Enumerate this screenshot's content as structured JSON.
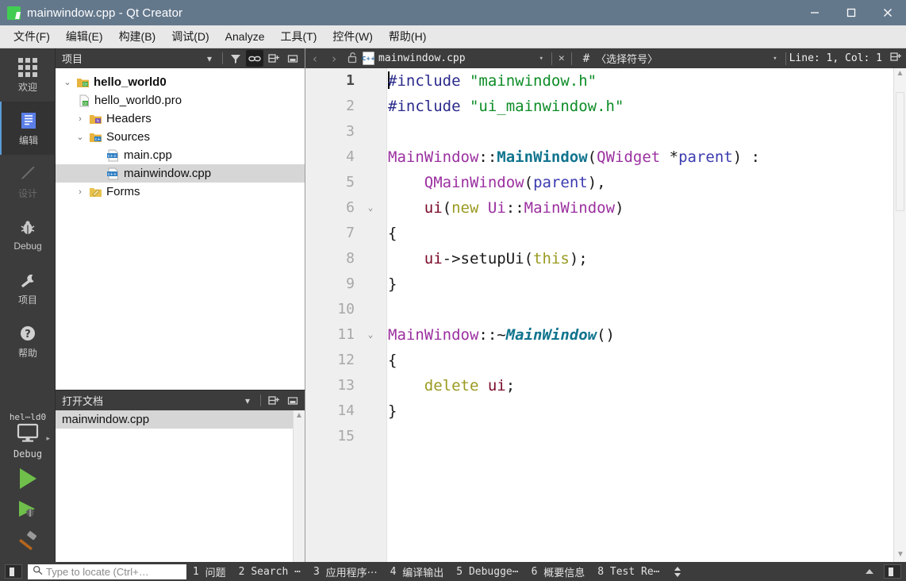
{
  "window": {
    "title": "mainwindow.cpp - Qt Creator",
    "app_icon": "qt-logo-icon",
    "minimize": "—",
    "maximize": "☐",
    "close": "✕",
    "titlebar_color": "#64788c"
  },
  "menubar": {
    "items": [
      {
        "label": "文件(F)",
        "mnemonic": "F"
      },
      {
        "label": "编辑(E)",
        "mnemonic": "E"
      },
      {
        "label": "构建(B)",
        "mnemonic": "B"
      },
      {
        "label": "调试(D)",
        "mnemonic": "D"
      },
      {
        "label": "Analyze",
        "mnemonic": "A"
      },
      {
        "label": "工具(T)",
        "mnemonic": "T"
      },
      {
        "label": "控件(W)",
        "mnemonic": "W"
      },
      {
        "label": "帮助(H)",
        "mnemonic": "H"
      }
    ]
  },
  "modebar": {
    "items": [
      {
        "label": "欢迎",
        "icon": "grid-icon",
        "state": "normal"
      },
      {
        "label": "编辑",
        "icon": "document-icon",
        "state": "selected"
      },
      {
        "label": "设计",
        "icon": "pencil-icon",
        "state": "disabled"
      },
      {
        "label": "Debug",
        "icon": "bug-icon",
        "state": "normal"
      },
      {
        "label": "项目",
        "icon": "wrench-icon",
        "state": "normal"
      },
      {
        "label": "帮助",
        "icon": "question-mark-icon",
        "state": "normal"
      }
    ],
    "kit": {
      "project": "hel⋯ld0",
      "config": "Debug",
      "icon": "monitor-icon"
    },
    "actions": [
      {
        "name": "run",
        "icon": "play-triangle-icon"
      },
      {
        "name": "debug",
        "icon": "play-bug-icon"
      },
      {
        "name": "build",
        "icon": "hammer-icon"
      }
    ]
  },
  "project_panel": {
    "title": "项目",
    "tools": [
      {
        "name": "filter-chevron",
        "glyph": "▾",
        "active": false
      },
      {
        "name": "filter-icon",
        "glyph": "▼",
        "active": false
      },
      {
        "name": "sync-link-icon",
        "glyph": "⚭",
        "active": true
      },
      {
        "name": "split-icon",
        "glyph": "⊞",
        "active": false
      },
      {
        "name": "close-panel-icon",
        "glyph": "▣",
        "active": false
      }
    ],
    "tree": [
      {
        "label": "hello_world0",
        "indent": 0,
        "arrow": "⌄",
        "icon": "qt-project-icon",
        "bold": true,
        "selected": false
      },
      {
        "label": "hello_world0.pro",
        "indent": 1,
        "arrow": "",
        "icon": "pro-file-icon",
        "bold": false,
        "selected": false
      },
      {
        "label": "Headers",
        "indent": 1,
        "arrow": "›",
        "icon": "headers-folder-icon",
        "bold": false,
        "selected": false
      },
      {
        "label": "Sources",
        "indent": 1,
        "arrow": "⌄",
        "icon": "sources-folder-icon",
        "bold": false,
        "selected": false
      },
      {
        "label": "main.cpp",
        "indent": 2,
        "arrow": "",
        "icon": "cpp-file-icon",
        "bold": false,
        "selected": false
      },
      {
        "label": "mainwindow.cpp",
        "indent": 2,
        "arrow": "",
        "icon": "cpp-file-icon",
        "bold": false,
        "selected": true
      },
      {
        "label": "Forms",
        "indent": 1,
        "arrow": "›",
        "icon": "forms-folder-icon",
        "bold": false,
        "selected": false
      }
    ]
  },
  "open_documents": {
    "title": "打开文档",
    "tools": [
      {
        "name": "chevron-down-icon",
        "glyph": "▾"
      },
      {
        "name": "split-icon",
        "glyph": "⊞"
      },
      {
        "name": "close-panel-icon",
        "glyph": "▣"
      }
    ],
    "items": [
      {
        "label": "mainwindow.cpp",
        "selected": true
      }
    ]
  },
  "editor_toolbar": {
    "back": "‹",
    "forward": "›",
    "lock_icon": "unlocked-padlock-icon",
    "file_icon": "cpp-file-icon",
    "file_icon_text": "C++",
    "filename": "mainwindow.cpp",
    "file_chevron": "▾",
    "close": "✕",
    "hash": "#",
    "symbol_selector": "〈选择符号〉",
    "symbol_chevron": "▾",
    "cursor_position": "Line: 1, Col: 1",
    "split_icon": "⊞"
  },
  "editor": {
    "lines": [
      {
        "num": "1",
        "fold": "",
        "current": true,
        "tokens": [
          {
            "t": "#include ",
            "c": "s-pre"
          },
          {
            "t": "\"mainwindow.h\"",
            "c": "s-str"
          }
        ]
      },
      {
        "num": "2",
        "fold": "",
        "current": false,
        "tokens": [
          {
            "t": "#include ",
            "c": "s-pre"
          },
          {
            "t": "\"ui_mainwindow.h\"",
            "c": "s-str"
          }
        ]
      },
      {
        "num": "3",
        "fold": "",
        "current": false,
        "tokens": []
      },
      {
        "num": "4",
        "fold": "",
        "current": false,
        "tokens": [
          {
            "t": "MainWindow",
            "c": "s-type"
          },
          {
            "t": "::",
            "c": "s-plain"
          },
          {
            "t": "MainWindow",
            "c": "s-fn"
          },
          {
            "t": "(",
            "c": "s-plain"
          },
          {
            "t": "QWidget",
            "c": "s-type"
          },
          {
            "t": " *",
            "c": "s-plain"
          },
          {
            "t": "parent",
            "c": "s-param"
          },
          {
            "t": ") :",
            "c": "s-plain"
          }
        ]
      },
      {
        "num": "5",
        "fold": "",
        "current": false,
        "tokens": [
          {
            "t": "    ",
            "c": "s-plain"
          },
          {
            "t": "QMainWindow",
            "c": "s-type"
          },
          {
            "t": "(",
            "c": "s-plain"
          },
          {
            "t": "parent",
            "c": "s-param"
          },
          {
            "t": "),",
            "c": "s-plain"
          }
        ]
      },
      {
        "num": "6",
        "fold": "⌄",
        "current": false,
        "tokens": [
          {
            "t": "    ",
            "c": "s-plain"
          },
          {
            "t": "ui",
            "c": "s-var"
          },
          {
            "t": "(",
            "c": "s-plain"
          },
          {
            "t": "new",
            "c": "s-kw"
          },
          {
            "t": " ",
            "c": "s-plain"
          },
          {
            "t": "Ui",
            "c": "s-type"
          },
          {
            "t": "::",
            "c": "s-plain"
          },
          {
            "t": "MainWindow",
            "c": "s-type"
          },
          {
            "t": ")",
            "c": "s-plain"
          }
        ]
      },
      {
        "num": "7",
        "fold": "",
        "current": false,
        "tokens": [
          {
            "t": "{",
            "c": "s-plain"
          }
        ]
      },
      {
        "num": "8",
        "fold": "",
        "current": false,
        "tokens": [
          {
            "t": "    ",
            "c": "s-plain"
          },
          {
            "t": "ui",
            "c": "s-var"
          },
          {
            "t": "->setupUi(",
            "c": "s-plain"
          },
          {
            "t": "this",
            "c": "s-kw"
          },
          {
            "t": ");",
            "c": "s-plain"
          }
        ]
      },
      {
        "num": "9",
        "fold": "",
        "current": false,
        "tokens": [
          {
            "t": "}",
            "c": "s-plain"
          }
        ]
      },
      {
        "num": "10",
        "fold": "",
        "current": false,
        "tokens": []
      },
      {
        "num": "11",
        "fold": "⌄",
        "current": false,
        "tokens": [
          {
            "t": "MainWindow",
            "c": "s-type"
          },
          {
            "t": "::~",
            "c": "s-plain"
          },
          {
            "t": "MainWindow",
            "c": "s-fni"
          },
          {
            "t": "()",
            "c": "s-plain"
          }
        ]
      },
      {
        "num": "12",
        "fold": "",
        "current": false,
        "tokens": [
          {
            "t": "{",
            "c": "s-plain"
          }
        ]
      },
      {
        "num": "13",
        "fold": "",
        "current": false,
        "tokens": [
          {
            "t": "    ",
            "c": "s-plain"
          },
          {
            "t": "delete",
            "c": "s-kw"
          },
          {
            "t": " ",
            "c": "s-plain"
          },
          {
            "t": "ui",
            "c": "s-var"
          },
          {
            "t": ";",
            "c": "s-plain"
          }
        ]
      },
      {
        "num": "14",
        "fold": "",
        "current": false,
        "tokens": [
          {
            "t": "}",
            "c": "s-plain"
          }
        ]
      },
      {
        "num": "15",
        "fold": "",
        "current": false,
        "tokens": []
      }
    ]
  },
  "statusbar": {
    "sidebar_toggle": "sidebar-toggle-icon",
    "locator_placeholder": "Type to locate (Ctrl+…",
    "locator_value": "",
    "search_icon": "magnifier-icon",
    "output_panes": [
      {
        "num": "1",
        "label": "问题"
      },
      {
        "num": "2",
        "label": "Search ⋯"
      },
      {
        "num": "3",
        "label": "应用程序⋯"
      },
      {
        "num": "4",
        "label": "编译输出"
      },
      {
        "num": "5",
        "label": "Debugge⋯"
      },
      {
        "num": "6",
        "label": "概要信息"
      },
      {
        "num": "8",
        "label": "Test Re⋯"
      }
    ],
    "right_controls": [
      {
        "name": "updown-arrows-icon",
        "glyph": "↕"
      },
      {
        "name": "collapse-up-icon",
        "glyph": "▴"
      },
      {
        "name": "output-toggle-icon",
        "glyph": "▣"
      }
    ]
  },
  "colors": {
    "titlebar": "#64788c",
    "chrome_dark": "#3c3c3c",
    "modebar": "#3c3c3c",
    "accent_selected": "#5b9bd5",
    "tree_selection": "#d6d6d6",
    "editor_bg": "#ffffff",
    "gutter_bg": "#efefef",
    "run_green": "#6fbf4a",
    "qt_green": "#41cd52"
  }
}
